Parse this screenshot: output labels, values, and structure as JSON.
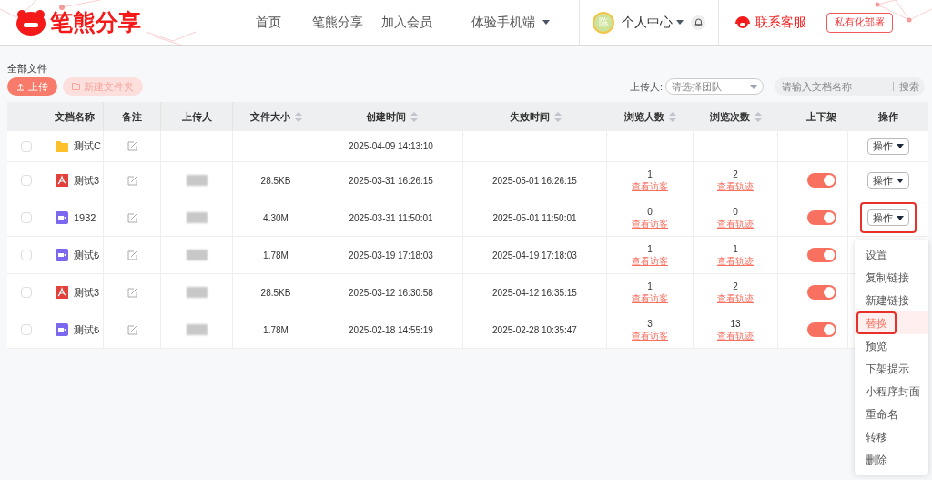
{
  "header": {
    "logo": "笔熊分享",
    "nav": [
      {
        "label": "首页",
        "dropdown": false
      },
      {
        "label": "笔熊分享",
        "dropdown": false
      },
      {
        "label": "加入会员",
        "dropdown": false
      },
      {
        "label": "体验手机端",
        "dropdown": true
      }
    ],
    "avatar": "陈",
    "user_menu": "个人中心",
    "support": "联系客服",
    "private_deploy": "私有化部署"
  },
  "breadcrumb": "全部文件",
  "toolbar": {
    "upload": "上传",
    "new_folder": "新建文件夹",
    "uploader_label": "上传人:",
    "uploader_placeholder": "请选择团队",
    "search_placeholder": "请输入文档名称",
    "search_button": "搜索"
  },
  "table": {
    "columns": [
      {
        "label": "文档名称",
        "sortable": false
      },
      {
        "label": "备注",
        "sortable": false
      },
      {
        "label": "上传人",
        "sortable": false
      },
      {
        "label": "文件大小",
        "sortable": true
      },
      {
        "label": "创建时间",
        "sortable": true
      },
      {
        "label": "失效时间",
        "sortable": true
      },
      {
        "label": "浏览人数",
        "sortable": true
      },
      {
        "label": "浏览次数",
        "sortable": true
      },
      {
        "label": "上下架",
        "sortable": false
      },
      {
        "label": "操作",
        "sortable": false
      }
    ],
    "rows": [
      {
        "checked": false,
        "kind": "folder",
        "name": "测试C",
        "uploader_redacted": false,
        "size": "",
        "created": "2025-04-09 14:13:10",
        "expires": "",
        "visitors": "",
        "visitors_link": "",
        "views": "",
        "views_link": "",
        "action": "操作",
        "highlighted": false
      },
      {
        "checked": false,
        "kind": "pdf",
        "name": "测试3",
        "uploader_redacted": true,
        "size": "28.5KB",
        "created": "2025-03-31 16:26:15",
        "expires": "2025-05-01 16:26:15",
        "visitors": "1",
        "visitors_link": "查看访客",
        "views": "2",
        "views_link": "查看轨迹",
        "on": true,
        "action": "操作",
        "highlighted": false
      },
      {
        "checked": false,
        "kind": "video",
        "name": "1932",
        "uploader_redacted": true,
        "size": "4.30M",
        "created": "2025-03-31 11:50:01",
        "expires": "2025-05-01 11:50:01",
        "visitors": "0",
        "visitors_link": "查看访客",
        "views": "0",
        "views_link": "查看轨迹",
        "on": true,
        "action": "操作",
        "highlighted": true
      },
      {
        "checked": false,
        "kind": "video",
        "name": "测试₺",
        "uploader_redacted": true,
        "size": "1.78M",
        "created": "2025-03-19 17:18:03",
        "expires": "2025-04-19 17:18:03",
        "visitors": "1",
        "visitors_link": "查看访客",
        "views": "1",
        "views_link": "查看轨迹",
        "on": true,
        "highlighted": false
      },
      {
        "checked": false,
        "kind": "pdf",
        "name": "测试3",
        "uploader_redacted": true,
        "size": "28.5KB",
        "created": "2025-03-12 16:30:58",
        "expires": "2025-04-12 16:35:15",
        "visitors": "1",
        "visitors_link": "查看访客",
        "views": "2",
        "views_link": "查看轨迹",
        "on": true,
        "highlighted": false
      },
      {
        "checked": false,
        "kind": "video",
        "name": "测试₺",
        "uploader_redacted": true,
        "size": "1.78M",
        "created": "2025-02-18 14:55:19",
        "expires": "2025-02-28 10:35:47",
        "visitors": "3",
        "visitors_link": "查看访客",
        "views": "13",
        "views_link": "查看轨迹",
        "on": true,
        "highlighted": false
      }
    ]
  },
  "action_menu": [
    {
      "label": "设置",
      "selected": false
    },
    {
      "label": "复制链接",
      "selected": false
    },
    {
      "label": "新建链接",
      "selected": false
    },
    {
      "label": "替换",
      "selected": true
    },
    {
      "label": "预览",
      "selected": false
    },
    {
      "label": "下架提示",
      "selected": false
    },
    {
      "label": "小程序封面",
      "selected": false
    },
    {
      "label": "重命名",
      "selected": false
    },
    {
      "label": "转移",
      "selected": false
    },
    {
      "label": "删除",
      "selected": false
    }
  ]
}
